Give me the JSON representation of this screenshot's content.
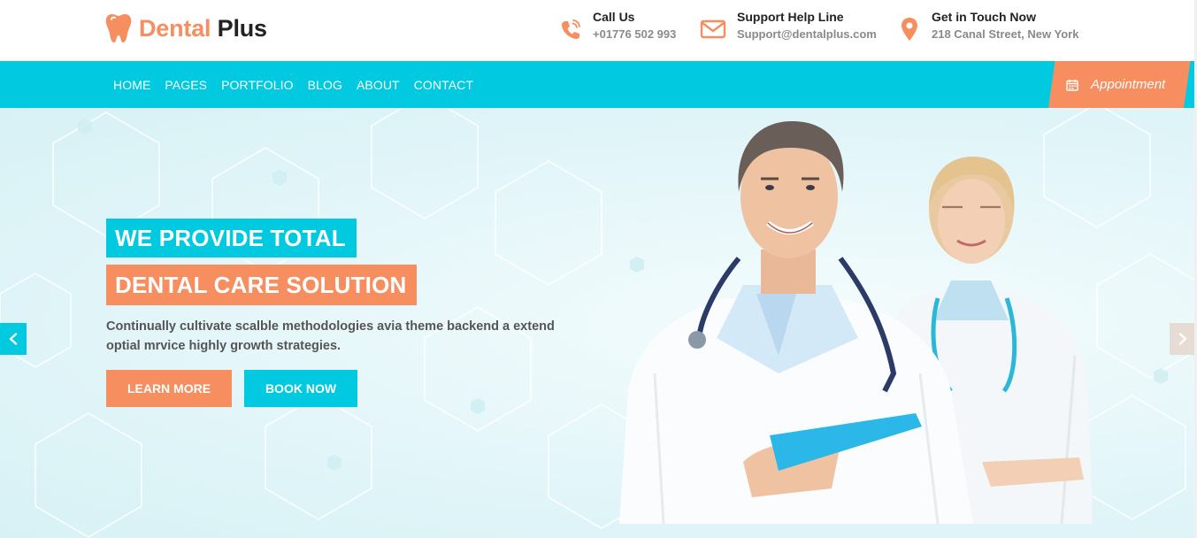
{
  "brand": {
    "name_part1": "Dental",
    "name_part2": "Plus",
    "accent": "#f68e5f",
    "primary": "#00c9e0",
    "logo_icon": "tooth-icon"
  },
  "contacts": [
    {
      "title": "Call Us",
      "value": "+01776 502 993",
      "icon": "phone-icon"
    },
    {
      "title": "Support Help Line",
      "value": "Support@dentalplus.com",
      "icon": "envelope-icon"
    },
    {
      "title": "Get in Touch Now",
      "value": "218 Canal Street, New York",
      "icon": "map-pin-icon"
    }
  ],
  "nav": {
    "items": [
      "HOME",
      "PAGES",
      "PORTFOLIO",
      "BLOG",
      "ABOUT",
      "CONTACT"
    ]
  },
  "appointment": {
    "label": "Appointment",
    "icon": "calendar-icon"
  },
  "hero": {
    "heading_line1": "WE PROVIDE TOTAL",
    "heading_line2": "DENTAL CARE SOLUTION",
    "description": "Continually cultivate scalble methodologies avia theme backend a extend optial mrvice highly growth strategies.",
    "learn_more": "LEARN MORE",
    "book_now": "BOOK NOW",
    "prev_icon": "chevron-left-icon",
    "next_icon": "chevron-right-icon"
  }
}
